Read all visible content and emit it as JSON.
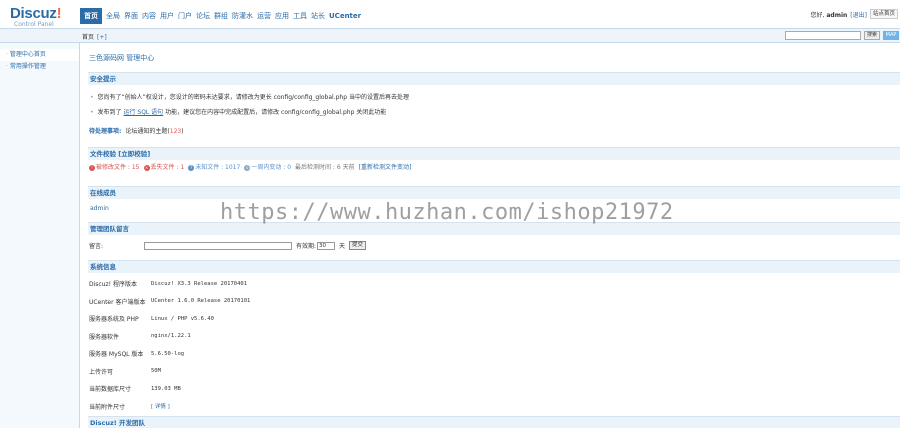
{
  "header": {
    "logo": "Discuz!",
    "logo_sub": "Control Panel",
    "nav": [
      "首页",
      "全局",
      "界面",
      "内容",
      "用户",
      "门户",
      "论坛",
      "群组",
      "防灌水",
      "运营",
      "应用",
      "工具",
      "站长",
      "UCenter"
    ],
    "greeting_prefix": "您好,",
    "username": "admin",
    "logout": "[退出]",
    "site_home": "站点首页"
  },
  "subbar": {
    "breadcrumb": "首页",
    "plus": "[+]",
    "search_button": "搜索",
    "map_button": "MAP"
  },
  "sidebar": {
    "items": [
      "管理中心首页",
      "常用操作管理"
    ]
  },
  "main": {
    "title": "三色源码网 管理中心",
    "security": {
      "heading": "安全提示",
      "tip1": "您尚有了“创始人”权设计，您设计的密码未达要求，请修改为更长 config/config_global.php 当中的设置后再去处理",
      "tip2_prefix": "发布到了",
      "tip2_link": "运行 SQL 语句",
      "tip2_suffix": "功能，建议您在内容中完成配置后，请修改 config/config_global.php 关闭此功能"
    },
    "pending": {
      "label": "待处理事项:",
      "text": "论坛通知的主题(",
      "count": "123",
      "close": ")"
    },
    "files": {
      "heading": "文件校验 [立即校验]",
      "modified_label": "被修改文件 :",
      "modified_count": "15",
      "lost_label": "丢失文件 :",
      "lost_count": "1",
      "unknown_label": "未知文件 :",
      "unknown_count": "1017",
      "week_label": "一周内变动 :",
      "week_count": "0",
      "last_label": "最后检测时间 :",
      "last_value": "6 天前",
      "again_link": "[重新检测文件变动]"
    },
    "online": {
      "heading": "在线成员",
      "user": "admin"
    },
    "message": {
      "heading": "管理团队留言",
      "label": "留言:",
      "expire_label": "有效期:",
      "expire_days": "30",
      "unit": "天",
      "submit": "提交"
    },
    "system": {
      "heading": "系统信息",
      "rows": [
        {
          "k": "Discuz! 程序版本",
          "v": "Discuz! X3.3 Release 20170401"
        },
        {
          "k": "UCenter 客户端版本",
          "v": "UCenter 1.6.0 Release 20170101"
        },
        {
          "k": "服务器系统及 PHP",
          "v": "Linux / PHP v5.6.40"
        },
        {
          "k": "服务器软件",
          "v": "nginx/1.22.1"
        },
        {
          "k": "服务器 MySQL 版本",
          "v": "5.6.50-log"
        },
        {
          "k": "上传许可",
          "v": "50M"
        },
        {
          "k": "当前数据库尺寸",
          "v": "139.03 MB"
        },
        {
          "k": "当前附件尺寸",
          "v": "[ 详情 ]"
        }
      ]
    },
    "team_heading": "Discuz! 开发团队"
  },
  "watermark": "https://www.huzhan.com/ishop21972",
  "colors": {
    "accent": "#2b6ca8",
    "section_bg": "#eaf2fa",
    "danger": "#d9534f"
  }
}
